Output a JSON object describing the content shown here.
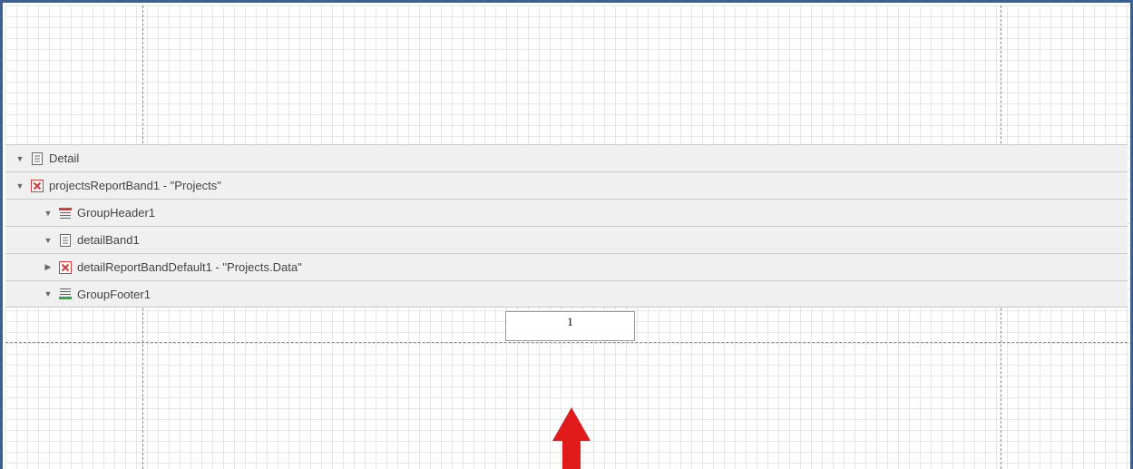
{
  "bands": [
    {
      "label": "Detail",
      "caret": "down",
      "icon": "detail-band-icon"
    },
    {
      "label": "projectsReportBand1 - \"Projects\"",
      "caret": "down",
      "icon": "report-band-icon"
    },
    {
      "label": "GroupHeader1",
      "caret": "down",
      "icon": "group-header-icon"
    },
    {
      "label": "detailBand1",
      "caret": "down",
      "icon": "detail-band-icon"
    },
    {
      "label": "detailReportBandDefault1 - \"Projects.Data\"",
      "caret": "right",
      "icon": "report-band-icon"
    },
    {
      "label": "GroupFooter1",
      "caret": "down",
      "icon": "group-footer-icon"
    }
  ],
  "page_number_field": {
    "value": "1"
  },
  "colors": {
    "frame_border": "#3f5f8f",
    "band_background": "#f0f0f0",
    "arrow": "#e11b1b",
    "report_band_icon": "#d83a3a",
    "group_header_icon": "#d83a3a",
    "group_footer_icon": "#2fa84a"
  },
  "caret_glyphs": {
    "down": "▼",
    "right": "▶"
  }
}
